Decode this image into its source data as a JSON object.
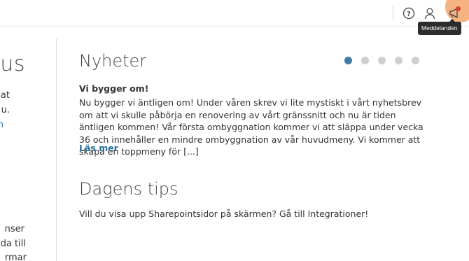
{
  "header": {
    "help_icon": "question-circle-icon",
    "user_icon": "user-icon",
    "notification_icon": "megaphone-icon",
    "notification_tooltip": "Meddelanden",
    "notification_badge_color": "#d9412b",
    "highlight_color": "#f5a46b"
  },
  "left_panel": {
    "heading": "tus",
    "lines": [
      "at",
      "u.",
      "n"
    ],
    "bottom_lines": [
      "nser",
      "da till",
      "rmar"
    ]
  },
  "news": {
    "title": "Nyheter",
    "carousel_dots": 5,
    "active_dot": 0,
    "accent_color": "#3f7aa3",
    "article_title": "Vi bygger om!",
    "article_body": "Nu bygger vi äntligen om! Under våren skrev vi lite mystiskt i vårt nyhetsbrev om att vi skulle påbörja en renovering av vårt gränssnitt och nu är tiden äntligen kommen! Vår första ombyggnation kommer vi att släppa under vecka 36 och innehåller en mindre ombyggnation av vår huvudmeny. Vi kommer att skapa en toppmeny för [...]",
    "read_more": "Läs mer"
  },
  "tips": {
    "title": "Dagens tips",
    "text": "Vill du visa upp Sharepointsidor på skärmen? Gå till Integrationer!"
  }
}
